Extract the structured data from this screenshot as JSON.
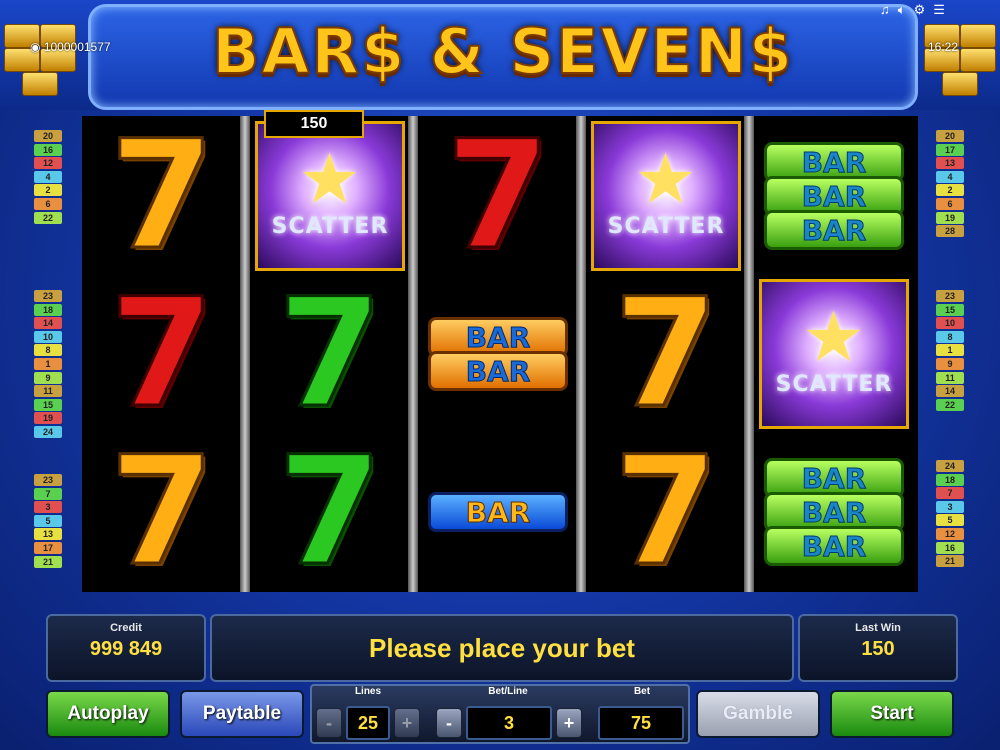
{
  "header": {
    "title": "BAR$ & SEVEN$",
    "credits_display": "1000001577",
    "time": "16:22"
  },
  "line_indicators": {
    "left_top": [
      "20",
      "16",
      "12",
      "4",
      "2",
      "6",
      "22"
    ],
    "left_middle": [
      "23",
      "18",
      "14",
      "10",
      "8",
      "1",
      "9",
      "11",
      "15",
      "19",
      "24"
    ],
    "left_bottom": [
      "23",
      "7",
      "3",
      "5",
      "13",
      "17",
      "21"
    ],
    "right_top": [
      "20",
      "17",
      "13",
      "4",
      "2",
      "6",
      "19",
      "28"
    ],
    "right_middle": [
      "23",
      "15",
      "10",
      "8",
      "1",
      "9",
      "11",
      "14",
      "22"
    ],
    "right_bottom": [
      "24",
      "18",
      "7",
      "3",
      "5",
      "12",
      "16",
      "21"
    ]
  },
  "reels": {
    "win_amount": "150",
    "scatter_label": "SCATTER",
    "bar_label": "BAR",
    "seven_label": "7"
  },
  "info": {
    "credit_label": "Credit",
    "credit_value": "999 849",
    "message": "Please place your bet",
    "last_win_label": "Last Win",
    "last_win_value": "150"
  },
  "controls": {
    "autoplay": "Autoplay",
    "paytable": "Paytable",
    "lines_label": "Lines",
    "lines_value": "25",
    "bet_line_label": "Bet/Line",
    "bet_line_value": "3",
    "bet_label": "Bet",
    "bet_value": "75",
    "gamble": "Gamble",
    "start": "Start",
    "minus": "-",
    "plus": "+"
  },
  "colors": {
    "accent_gold": "#ffe040",
    "line_tab_colors": [
      "#c8a040",
      "#5ad050",
      "#e05050",
      "#5ac8e8",
      "#e8e040",
      "#e89040",
      "#a0e050"
    ]
  }
}
